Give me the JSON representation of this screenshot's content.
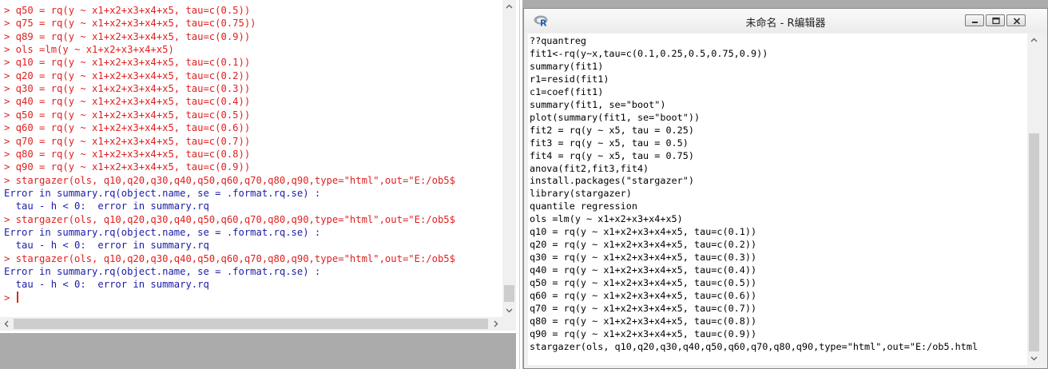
{
  "console": {
    "lines": [
      {
        "t": "> q50 = rq(y ~ x1+x2+x3+x4+x5, tau=c(0.5))",
        "k": "cmd"
      },
      {
        "t": "> q75 = rq(y ~ x1+x2+x3+x4+x5, tau=c(0.75))",
        "k": "cmd"
      },
      {
        "t": "> q89 = rq(y ~ x1+x2+x3+x4+x5, tau=c(0.9))",
        "k": "cmd"
      },
      {
        "t": "> ols =lm(y ~ x1+x2+x3+x4+x5)",
        "k": "cmd"
      },
      {
        "t": "> q10 = rq(y ~ x1+x2+x3+x4+x5, tau=c(0.1))",
        "k": "cmd"
      },
      {
        "t": "> q20 = rq(y ~ x1+x2+x3+x4+x5, tau=c(0.2))",
        "k": "cmd"
      },
      {
        "t": "> q30 = rq(y ~ x1+x2+x3+x4+x5, tau=c(0.3))",
        "k": "cmd"
      },
      {
        "t": "> q40 = rq(y ~ x1+x2+x3+x4+x5, tau=c(0.4))",
        "k": "cmd"
      },
      {
        "t": "> q50 = rq(y ~ x1+x2+x3+x4+x5, tau=c(0.5))",
        "k": "cmd"
      },
      {
        "t": "> q60 = rq(y ~ x1+x2+x3+x4+x5, tau=c(0.6))",
        "k": "cmd"
      },
      {
        "t": "> q70 = rq(y ~ x1+x2+x3+x4+x5, tau=c(0.7))",
        "k": "cmd"
      },
      {
        "t": "> q80 = rq(y ~ x1+x2+x3+x4+x5, tau=c(0.8))",
        "k": "cmd"
      },
      {
        "t": "> q90 = rq(y ~ x1+x2+x3+x4+x5, tau=c(0.9))",
        "k": "cmd"
      },
      {
        "t": "> stargazer(ols, q10,q20,q30,q40,q50,q60,q70,q80,q90,type=\"html\",out=\"E:/ob5$",
        "k": "cmd"
      },
      {
        "t": "Error in summary.rq(object.name, se = .format.rq.se) :",
        "k": "out"
      },
      {
        "t": "  tau - h < 0:  error in summary.rq",
        "k": "out"
      },
      {
        "t": "> stargazer(ols, q10,q20,q30,q40,q50,q60,q70,q80,q90,type=\"html\",out=\"E:/ob5$",
        "k": "cmd"
      },
      {
        "t": "Error in summary.rq(object.name, se = .format.rq.se) :",
        "k": "out"
      },
      {
        "t": "  tau - h < 0:  error in summary.rq",
        "k": "out"
      },
      {
        "t": "> stargazer(ols, q10,q20,q30,q40,q50,q60,q70,q80,q90,type=\"html\",out=\"E:/ob5$",
        "k": "cmd"
      },
      {
        "t": "Error in summary.rq(object.name, se = .format.rq.se) :",
        "k": "out"
      },
      {
        "t": "  tau - h < 0:  error in summary.rq",
        "k": "out"
      }
    ],
    "prompt": "> "
  },
  "editor": {
    "title": "未命名 - R编辑器",
    "lines": [
      "??quantreg",
      "fit1<-rq(y~x,tau=c(0.1,0.25,0.5,0.75,0.9))",
      "summary(fit1)",
      "r1=resid(fit1)",
      "c1=coef(fit1)",
      "summary(fit1, se=\"boot\")",
      "plot(summary(fit1, se=\"boot\"))",
      "fit2 = rq(y ~ x5, tau = 0.25)",
      "fit3 = rq(y ~ x5, tau = 0.5)",
      "fit4 = rq(y ~ x5, tau = 0.75)",
      "anova(fit2,fit3,fit4)",
      "install.packages(\"stargazer\")",
      "library(stargazer)",
      "quantile regression",
      "ols =lm(y ~ x1+x2+x3+x4+x5)",
      "q10 = rq(y ~ x1+x2+x3+x4+x5, tau=c(0.1))",
      "q20 = rq(y ~ x1+x2+x3+x4+x5, tau=c(0.2))",
      "q30 = rq(y ~ x1+x2+x3+x4+x5, tau=c(0.3))",
      "q40 = rq(y ~ x1+x2+x3+x4+x5, tau=c(0.4))",
      "q50 = rq(y ~ x1+x2+x3+x4+x5, tau=c(0.5))",
      "q60 = rq(y ~ x1+x2+x3+x4+x5, tau=c(0.6))",
      "q70 = rq(y ~ x1+x2+x3+x4+x5, tau=c(0.7))",
      "q80 = rq(y ~ x1+x2+x3+x4+x5, tau=c(0.8))",
      "q90 = rq(y ~ x1+x2+x3+x4+x5, tau=c(0.9))",
      "stargazer(ols, q10,q20,q30,q40,q50,q60,q70,q80,q90,type=\"html\",out=\"E:/ob5.html"
    ],
    "window_buttons": {
      "minimize": "minimize-icon",
      "maximize": "maximize-icon",
      "close": "close-icon"
    },
    "logo": "r-logo-icon"
  },
  "colors": {
    "command": "#e02020",
    "output": "#1b1ba8",
    "scroll_thumb": "#cdcdcd"
  }
}
